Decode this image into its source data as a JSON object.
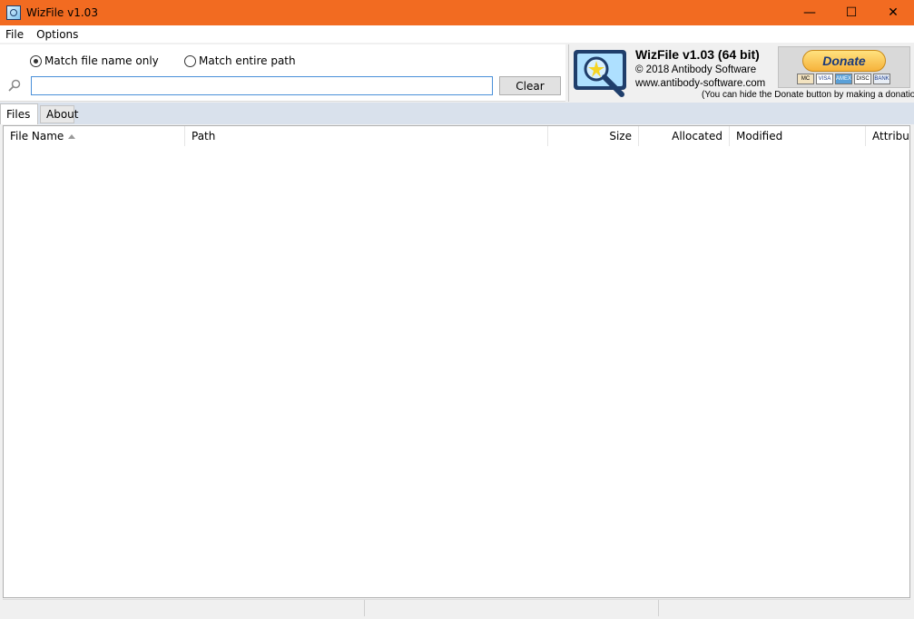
{
  "window": {
    "title": "WizFile v1.03",
    "controls": {
      "minimize": "—",
      "maximize": "☐",
      "close": "✕"
    }
  },
  "menu": {
    "items": [
      "File",
      "Options"
    ]
  },
  "search": {
    "radio_name_only": "Match file name only",
    "radio_entire_path": "Match entire path",
    "selected": "name_only",
    "query": "",
    "clear_label": "Clear"
  },
  "brand": {
    "title": "WizFile v1.03 (64 bit)",
    "copyright": "© 2018 Antibody Software",
    "url": "www.antibody-software.com",
    "donate_label": "Donate",
    "donate_hint": "(You can hide the Donate button by making a donation)",
    "cards": [
      "MC",
      "VISA",
      "AMEX",
      "DISC",
      "BANK"
    ]
  },
  "tabs": [
    {
      "label": "Files",
      "active": true
    },
    {
      "label": "About",
      "active": false
    }
  ],
  "table": {
    "columns": [
      "File Name",
      "Path",
      "Size",
      "Allocated",
      "Modified",
      "Attributes"
    ],
    "sort_column": "File Name",
    "rows": []
  },
  "status": {
    "segments": [
      "",
      "",
      ""
    ]
  },
  "colors": {
    "titlebar": "#f26b21",
    "accent": "#4a90d9",
    "tabstrip": "#d9e1ec"
  }
}
